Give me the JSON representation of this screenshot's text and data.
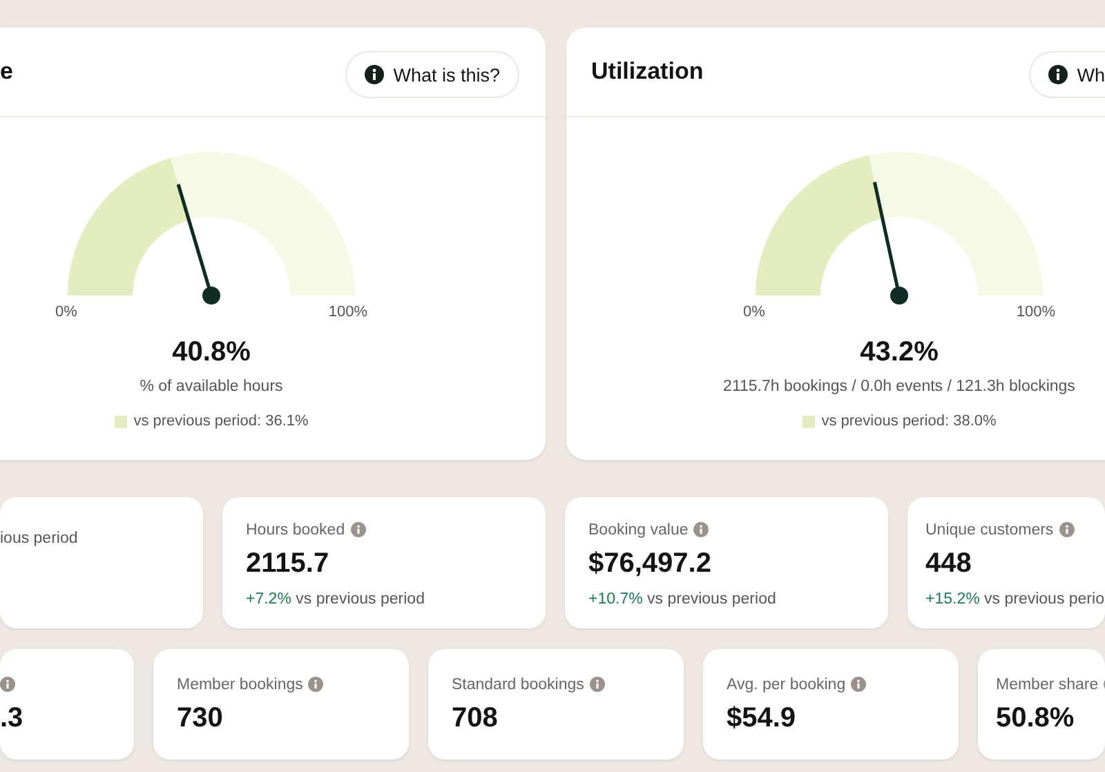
{
  "gauge_cards": [
    {
      "title": "e",
      "info_button": "What is this?",
      "gauge": {
        "min_label": "0%",
        "max_label": "100%"
      },
      "value": "40.8%",
      "subtitle": "% of available hours",
      "comparison": "vs previous period: 36.1%"
    },
    {
      "title": "Utilization",
      "info_button": "Wh",
      "gauge": {
        "min_label": "0%",
        "max_label": "100%"
      },
      "value": "43.2%",
      "subtitle": "2115.7h bookings / 0.0h events / 121.3h blockings",
      "comparison": "vs previous period: 38.0%"
    }
  ],
  "stat_rows": [
    {
      "cards": [
        {
          "info": false,
          "comparison": "ious period"
        },
        {
          "label": "Hours booked",
          "info": true,
          "value": "2115.7",
          "change": "+7.2%",
          "comparison": "vs previous period"
        },
        {
          "label": "Booking value",
          "info": true,
          "value": "$76,497.2",
          "change": "+10.7%",
          "comparison": "vs previous period"
        },
        {
          "label": "Unique customers",
          "info": true,
          "value": "448",
          "change": "+15.2%",
          "comparison": "vs previous perio"
        }
      ]
    },
    {
      "cards": [
        {
          "info": true,
          "value": ".3"
        },
        {
          "label": "Member bookings",
          "info": true,
          "value": "730"
        },
        {
          "label": "Standard bookings",
          "info": true,
          "value": "708"
        },
        {
          "label": "Avg. per booking",
          "info": true,
          "value": "$54.9"
        },
        {
          "label": "Member share",
          "info": true,
          "value": "50.8%"
        }
      ]
    }
  ]
}
